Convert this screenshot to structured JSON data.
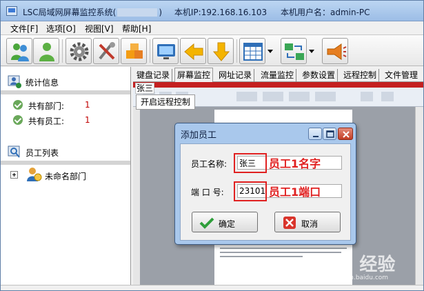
{
  "window": {
    "title_prefix": "LSC局域网屏幕监控系统(",
    "title_suffix": ")",
    "ip_label": "本机IP:192.168.16.103",
    "user_label": "本机用户名：admin-PC"
  },
  "menu": [
    {
      "label": "文件[F]"
    },
    {
      "label": "选项[O]"
    },
    {
      "label": "视图[V]"
    },
    {
      "label": "帮助[H]"
    }
  ],
  "toolbar": {
    "buttons": [
      {
        "icon": "users-icon"
      },
      {
        "icon": "user-icon"
      },
      {
        "icon": "gear-icon"
      },
      {
        "icon": "tools-icon"
      },
      {
        "icon": "boxes-icon"
      },
      {
        "icon": "monitor-icon"
      },
      {
        "icon": "arrow-left-icon"
      },
      {
        "icon": "arrow-down-icon"
      },
      {
        "icon": "grid-window-icon"
      },
      {
        "icon": "network-transfer-icon"
      },
      {
        "icon": "megaphone-icon"
      }
    ]
  },
  "sidebar": {
    "stats_title": "统计信息",
    "stats": [
      {
        "label": "共有部门:",
        "value": "1"
      },
      {
        "label": "共有员工:",
        "value": "1"
      }
    ],
    "employee_list_title": "员工列表",
    "tree": [
      {
        "label": "未命名部门"
      }
    ]
  },
  "tabs": [
    {
      "label": "键盘记录",
      "active": false
    },
    {
      "label": "屏幕监控",
      "active": true
    },
    {
      "label": "网址记录",
      "active": false
    },
    {
      "label": "流量监控",
      "active": false
    },
    {
      "label": "参数设置",
      "active": false
    },
    {
      "label": "远程控制",
      "active": false
    },
    {
      "label": "文件管理",
      "active": false
    }
  ],
  "content": {
    "user_tag": "张三",
    "remote_button": "开启远程控制"
  },
  "dialog": {
    "title": "添加员工",
    "name_label": "员工名称:",
    "name_value": "张三",
    "name_annotation": "员工1名字",
    "port_label": "端 口 号:",
    "port_value": "23101",
    "port_annotation": "员工1端口",
    "ok_label": "确定",
    "cancel_label": "取消"
  },
  "colors": {
    "accent_red": "#e02020",
    "stat_value": "#c00000",
    "dialog_frame": "#a9c8ec"
  },
  "watermark": {
    "main": "Bai 经验",
    "sub": "jingyan.baidu.com"
  }
}
